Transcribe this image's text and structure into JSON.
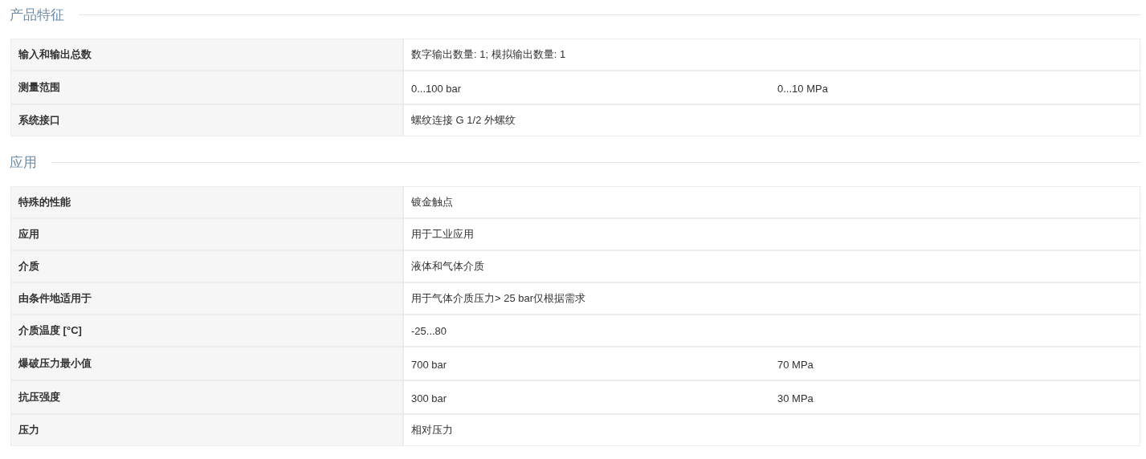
{
  "sections": [
    {
      "title": "产品特征",
      "rows": [
        {
          "label": "输入和输出总数",
          "values": [
            "数字输出数量: 1; 模拟输出数量: 1"
          ]
        },
        {
          "label": "测量范围",
          "values": [
            "0...100 bar",
            "0...10 MPa"
          ]
        },
        {
          "label": "系统接口",
          "values": [
            "螺纹连接 G 1/2 外螺纹"
          ]
        }
      ]
    },
    {
      "title": "应用",
      "rows": [
        {
          "label": "特殊的性能",
          "values": [
            "镀金触点"
          ]
        },
        {
          "label": "应用",
          "values": [
            "用于工业应用"
          ]
        },
        {
          "label": "介质",
          "values": [
            "液体和气体介质"
          ]
        },
        {
          "label": "由条件地适用于",
          "values": [
            "用于气体介质压力> 25 bar仅根据需求"
          ]
        },
        {
          "label": "介质温度 [°C]",
          "values": [
            "-25...80"
          ]
        },
        {
          "label": "爆破压力最小值",
          "values": [
            "700 bar",
            "70 MPa"
          ]
        },
        {
          "label": "抗压强度",
          "values": [
            "300 bar",
            "30 MPa"
          ]
        },
        {
          "label": "压力",
          "values": [
            "相对压力"
          ]
        }
      ]
    }
  ]
}
